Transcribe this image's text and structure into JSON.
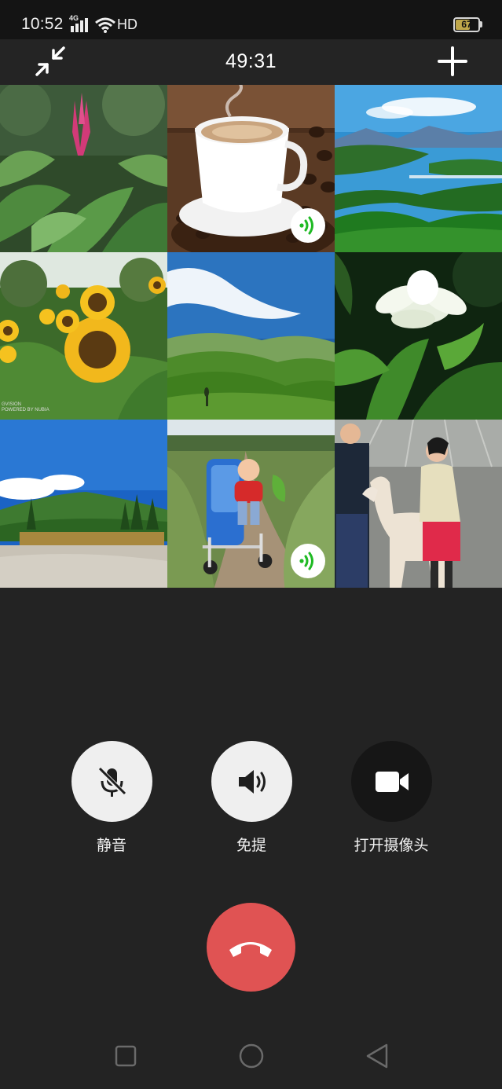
{
  "status_bar": {
    "time": "10:52",
    "network": "4G",
    "hd": "HD",
    "battery_level": "67",
    "battery_fraction": 0.67
  },
  "call": {
    "duration": "49:31"
  },
  "participants": [
    {
      "subject": "flowers",
      "speaking": false
    },
    {
      "subject": "coffee",
      "speaking": true
    },
    {
      "subject": "lake",
      "speaking": false
    },
    {
      "subject": "sunflowers",
      "speaking": false,
      "watermark": "GVISION\nPOWERED BY NUBIA"
    },
    {
      "subject": "green-hills",
      "speaking": false
    },
    {
      "subject": "white-flower",
      "speaking": false
    },
    {
      "subject": "mountain",
      "speaking": false
    },
    {
      "subject": "baby-stroller",
      "speaking": true
    },
    {
      "subject": "alpaca",
      "speaking": false
    }
  ],
  "controls": {
    "mute_label": "静音",
    "speaker_label": "免提",
    "camera_label": "打开摄像头"
  },
  "colors": {
    "background": "#232323",
    "hangup": "#e05353",
    "speaking": "#1fba24"
  }
}
